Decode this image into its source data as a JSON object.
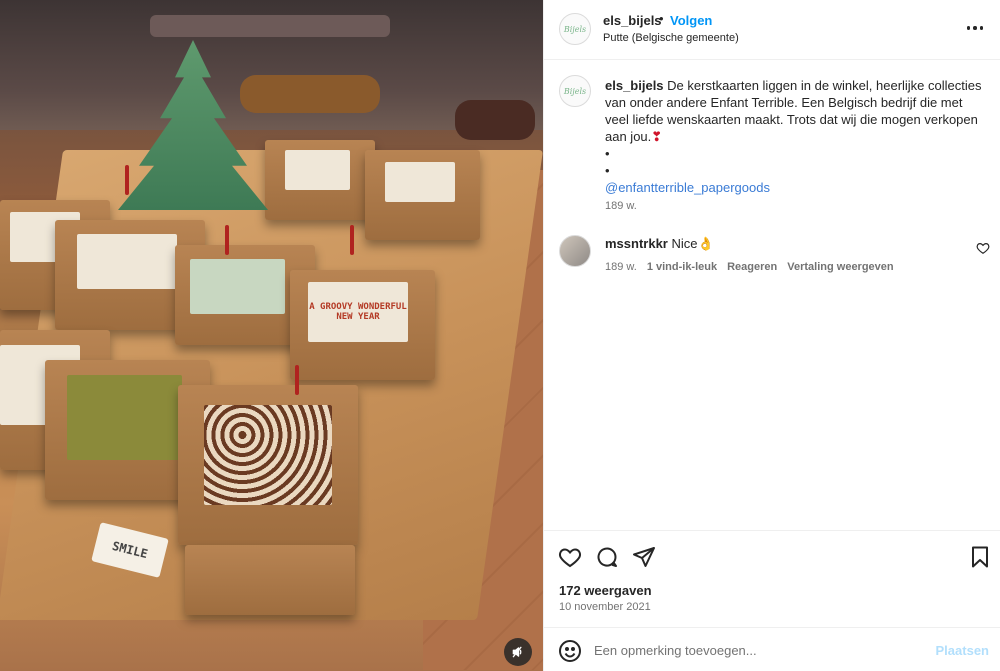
{
  "post": {
    "username": "els_bijels",
    "separator": "•",
    "follow_label": "Volgen",
    "location": "Putte (Belgische gemeente)",
    "avatar_text": "Bijels"
  },
  "caption": {
    "username": "els_bijels",
    "text": "De kerstkaarten liggen in de winkel, heerlijke collecties van onder andere Enfant Terrible. Een Belgisch bedrijf die met veel liefde wenskaarten maakt. Trots dat wij die mogen verkopen aan jou.",
    "emoji": "❣",
    "bullet1": "•",
    "bullet2": "•",
    "mention": "@enfantterrible_papergoods",
    "time": "189 w."
  },
  "comment": {
    "username": "mssntrkkr",
    "text": "Nice👌",
    "time": "189 w.",
    "likes": "1 vind-ik-leuk",
    "reply_label": "Reageren",
    "translate_label": "Vertaling weergeven"
  },
  "stats": {
    "views": "172 weergaven",
    "date": "10 november 2021"
  },
  "comment_box": {
    "placeholder": "Een opmerking toevoegen...",
    "post_label": "Plaatsen"
  },
  "media": {
    "sign_text": "SMILE",
    "card_text": "A GROOVY WONDERFUL NEW YEAR"
  },
  "icons": {
    "more": "more-horizontal-icon",
    "like": "heart-icon",
    "comment": "comment-icon",
    "share": "send-icon",
    "save": "bookmark-icon",
    "emoji": "emoji-icon",
    "mute": "muted-speaker-icon"
  },
  "colors": {
    "link": "#0095f6",
    "mention": "#3a7bd5",
    "post_disabled": "#b2dffc",
    "muted_text": "#737373"
  }
}
